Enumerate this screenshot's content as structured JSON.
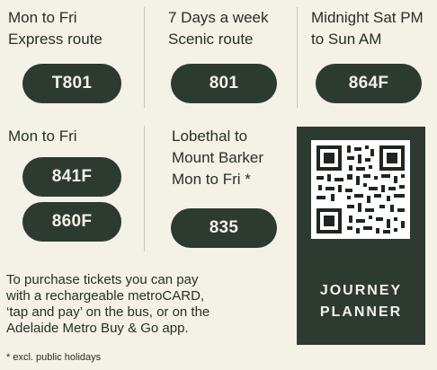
{
  "services": [
    {
      "line1": "Mon to Fri",
      "line2": "Express route",
      "routes": [
        "T801"
      ]
    },
    {
      "line1": "7 Days a week",
      "line2": "Scenic route",
      "routes": [
        "801"
      ]
    },
    {
      "line1": "Midnight Sat PM",
      "line2": "to Sun AM",
      "routes": [
        "864F"
      ]
    },
    {
      "line1": "Mon to Fri",
      "routes": [
        "841F",
        "860F"
      ]
    },
    {
      "line1": "Lobethal to",
      "line2": "Mount Barker",
      "line3": "Mon to Fri *",
      "routes": [
        "835"
      ]
    }
  ],
  "info": {
    "line1": "To purchase tickets you can pay",
    "line2": "with a rechargeable metroCARD,",
    "line3": "‘tap and pay’ on the bus, or on the",
    "line4": "Adelaide Metro Buy & Go app."
  },
  "footnote": "* excl. public holidays",
  "planner": {
    "line1": "JOURNEY",
    "line2": "PLANNER"
  },
  "colors": {
    "background": "#f4f1e7",
    "accent": "#2d3a30",
    "text": "#243027"
  }
}
